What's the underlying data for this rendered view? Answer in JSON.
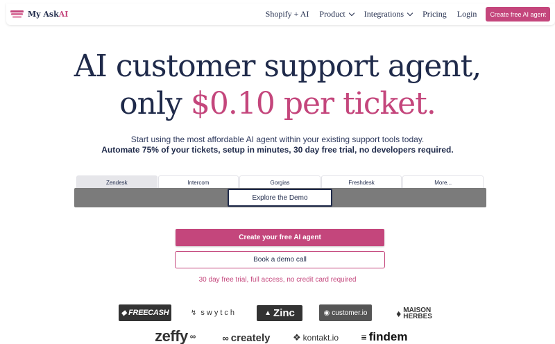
{
  "nav": {
    "brand_prefix": "My Ask",
    "brand_suffix": "AI",
    "links": [
      {
        "label": "Shopify + AI"
      },
      {
        "label": "Product"
      },
      {
        "label": "Integrations"
      },
      {
        "label": "Pricing"
      },
      {
        "label": "Login"
      }
    ],
    "cta": "Create free AI agent"
  },
  "hero": {
    "line1": "AI customer support agent,",
    "line2_prefix": "only ",
    "line2_highlight": "$0.10 per ticket.",
    "subtitle": "Start using the most affordable AI agent within your existing support tools today.",
    "subtitle_bold": "Automate 75% of your tickets, setup in minutes, 30 day free trial, no developers required."
  },
  "demo": {
    "tabs": [
      {
        "label": "Zendesk",
        "active": true
      },
      {
        "label": "Intercom",
        "active": false
      },
      {
        "label": "Gorgias",
        "active": false
      },
      {
        "label": "Freshdesk",
        "active": false
      },
      {
        "label": "More...",
        "active": false
      }
    ],
    "explore_label": "Explore the Demo"
  },
  "cta": {
    "primary": "Create your free AI agent",
    "secondary": "Book a demo call",
    "note": "30 day free trial, full access, no credit card required"
  },
  "logos": {
    "freecash": "FREECASH",
    "swytch": "swytch",
    "zinc": "Zinc",
    "customer": "customer.io",
    "maison_1": "MAISON",
    "maison_2": "HERBES",
    "zeffy": "zeffy",
    "creately": "creately",
    "kontakt": "kontakt.io",
    "findem": "findem"
  },
  "colors": {
    "brand_pink": "#c4467c",
    "navy": "#1f2a4a"
  }
}
